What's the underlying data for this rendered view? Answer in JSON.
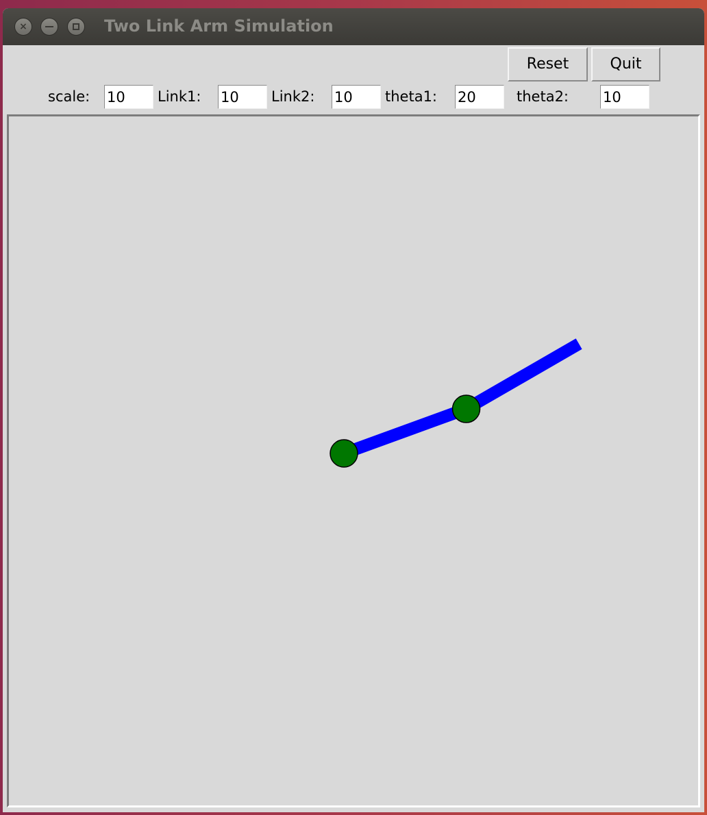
{
  "window": {
    "title": "Two Link Arm Simulation"
  },
  "toolbar": {
    "reset_label": "Reset",
    "quit_label": "Quit"
  },
  "params": {
    "scale_label": "scale:",
    "scale_value": "10",
    "link1_label": "Link1:",
    "link1_value": "10",
    "link2_label": "Link2:",
    "link2_value": "10",
    "theta1_label": "theta1:",
    "theta1_value": "20",
    "theta2_label": "theta2:",
    "theta2_value": "10"
  },
  "canvas": {
    "background": "#d9d9d9",
    "link_color": "#0000ff",
    "joint_color": "#007700",
    "joint_outline": "#000000"
  }
}
